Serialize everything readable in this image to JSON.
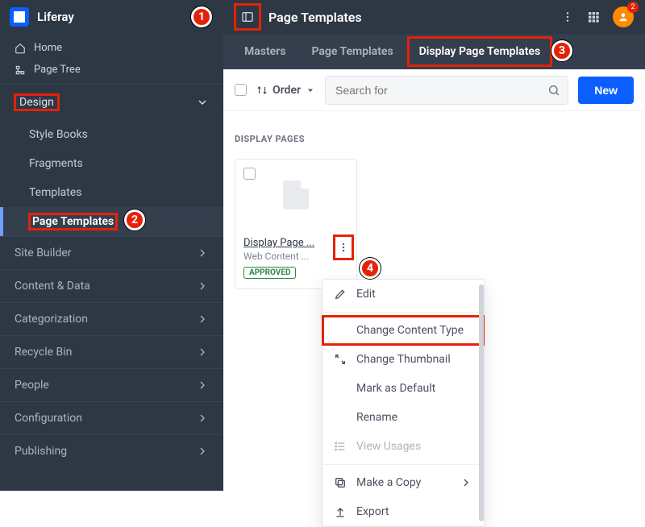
{
  "brand": "Liferay",
  "page_title": "Page Templates",
  "notifications": "2",
  "sidebar": {
    "top": {
      "home": "Home",
      "page_tree": "Page Tree"
    },
    "design": {
      "label": "Design",
      "items": [
        "Style Books",
        "Fragments",
        "Templates",
        "Page Templates"
      ]
    },
    "groups": [
      "Site Builder",
      "Content & Data",
      "Categorization",
      "Recycle Bin",
      "People",
      "Configuration",
      "Publishing"
    ]
  },
  "tabs": {
    "masters": "Masters",
    "page_templates": "Page Templates",
    "display_page_templates": "Display Page Templates"
  },
  "toolbar": {
    "order_label": "Order",
    "search_placeholder": "Search for",
    "new_label": "New"
  },
  "section_label": "DISPLAY PAGES",
  "card": {
    "title": "Display Page ...",
    "subtitle": "Web Content ...",
    "status": "APPROVED"
  },
  "menu": {
    "edit": "Edit",
    "change_content_type": "Change Content Type",
    "change_thumbnail": "Change Thumbnail",
    "mark_default": "Mark as Default",
    "rename": "Rename",
    "view_usages": "View Usages",
    "make_copy": "Make a Copy",
    "export": "Export"
  },
  "callouts": {
    "c1": "1",
    "c2": "2",
    "c3": "3",
    "c4": "4"
  }
}
